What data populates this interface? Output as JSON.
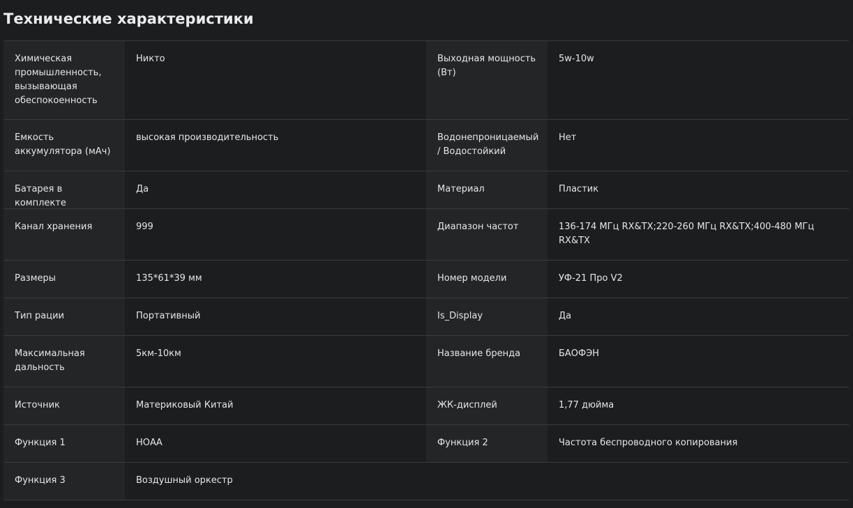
{
  "title": "Технические характеристики",
  "rows": [
    {
      "l1": "Химическая промышленность, вызывающая обеспокоенность",
      "v1": "Никто",
      "l2": "Выходная мощность (Вт)",
      "v2": "5w-10w"
    },
    {
      "l1": "Емкость аккумулятора (мАч)",
      "v1": "высокая производительность",
      "l2": "Водонепроницаемый / Водостойкий",
      "v2": "Нет"
    },
    {
      "l1": "Батарея в комплекте",
      "v1": "Да",
      "l2": "Материал",
      "v2": "Пластик"
    },
    {
      "l1": "Канал хранения",
      "v1": "999",
      "l2": "Диапазон частот",
      "v2": "136-174 МГц RX&TX;220-260 МГц RX&TX;400-480 МГц RX&TX"
    },
    {
      "l1": "Размеры",
      "v1": "135*61*39 мм",
      "l2": "Номер модели",
      "v2": "УФ-21 Про V2"
    },
    {
      "l1": "Тип рации",
      "v1": "Портативный",
      "l2": "Is_Display",
      "v2": "Да"
    },
    {
      "l1": "Максимальная дальность",
      "v1": "5км-10км",
      "l2": "Название бренда",
      "v2": "БАОФЭН"
    },
    {
      "l1": "Источник",
      "v1": "Материковый Китай",
      "l2": "ЖК-дисплей",
      "v2": "1,77 дюйма"
    },
    {
      "l1": "Функция 1",
      "v1": "НОАА",
      "l2": "Функция 2",
      "v2": "Частота беспроводного копирования"
    },
    {
      "l1": "Функция 3",
      "v1": "Воздушный оркестр",
      "l2": "",
      "v2": ""
    }
  ]
}
